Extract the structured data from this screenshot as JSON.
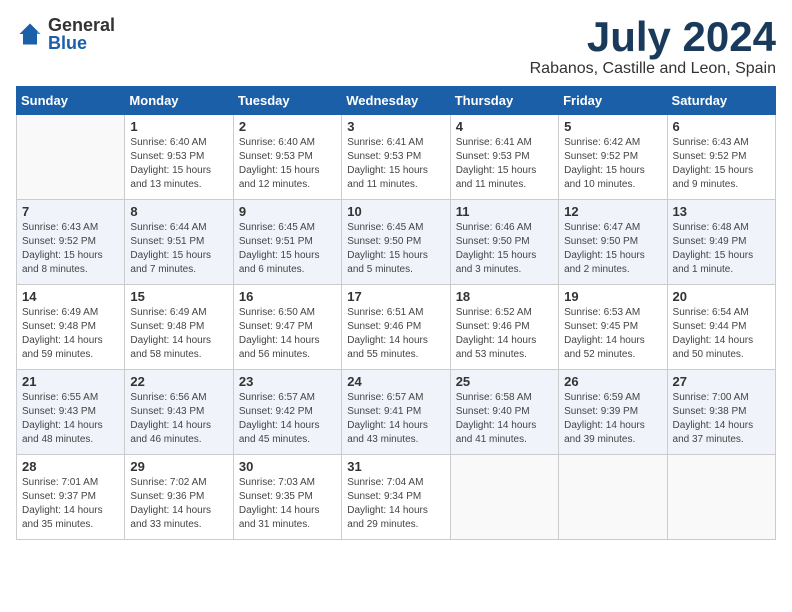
{
  "logo": {
    "general": "General",
    "blue": "Blue"
  },
  "title": "July 2024",
  "location": "Rabanos, Castille and Leon, Spain",
  "days_of_week": [
    "Sunday",
    "Monday",
    "Tuesday",
    "Wednesday",
    "Thursday",
    "Friday",
    "Saturday"
  ],
  "weeks": [
    [
      {
        "day": "",
        "sunrise": "",
        "sunset": "",
        "daylight": ""
      },
      {
        "day": "1",
        "sunrise": "Sunrise: 6:40 AM",
        "sunset": "Sunset: 9:53 PM",
        "daylight": "Daylight: 15 hours and 13 minutes."
      },
      {
        "day": "2",
        "sunrise": "Sunrise: 6:40 AM",
        "sunset": "Sunset: 9:53 PM",
        "daylight": "Daylight: 15 hours and 12 minutes."
      },
      {
        "day": "3",
        "sunrise": "Sunrise: 6:41 AM",
        "sunset": "Sunset: 9:53 PM",
        "daylight": "Daylight: 15 hours and 11 minutes."
      },
      {
        "day": "4",
        "sunrise": "Sunrise: 6:41 AM",
        "sunset": "Sunset: 9:53 PM",
        "daylight": "Daylight: 15 hours and 11 minutes."
      },
      {
        "day": "5",
        "sunrise": "Sunrise: 6:42 AM",
        "sunset": "Sunset: 9:52 PM",
        "daylight": "Daylight: 15 hours and 10 minutes."
      },
      {
        "day": "6",
        "sunrise": "Sunrise: 6:43 AM",
        "sunset": "Sunset: 9:52 PM",
        "daylight": "Daylight: 15 hours and 9 minutes."
      }
    ],
    [
      {
        "day": "7",
        "sunrise": "Sunrise: 6:43 AM",
        "sunset": "Sunset: 9:52 PM",
        "daylight": "Daylight: 15 hours and 8 minutes."
      },
      {
        "day": "8",
        "sunrise": "Sunrise: 6:44 AM",
        "sunset": "Sunset: 9:51 PM",
        "daylight": "Daylight: 15 hours and 7 minutes."
      },
      {
        "day": "9",
        "sunrise": "Sunrise: 6:45 AM",
        "sunset": "Sunset: 9:51 PM",
        "daylight": "Daylight: 15 hours and 6 minutes."
      },
      {
        "day": "10",
        "sunrise": "Sunrise: 6:45 AM",
        "sunset": "Sunset: 9:50 PM",
        "daylight": "Daylight: 15 hours and 5 minutes."
      },
      {
        "day": "11",
        "sunrise": "Sunrise: 6:46 AM",
        "sunset": "Sunset: 9:50 PM",
        "daylight": "Daylight: 15 hours and 3 minutes."
      },
      {
        "day": "12",
        "sunrise": "Sunrise: 6:47 AM",
        "sunset": "Sunset: 9:50 PM",
        "daylight": "Daylight: 15 hours and 2 minutes."
      },
      {
        "day": "13",
        "sunrise": "Sunrise: 6:48 AM",
        "sunset": "Sunset: 9:49 PM",
        "daylight": "Daylight: 15 hours and 1 minute."
      }
    ],
    [
      {
        "day": "14",
        "sunrise": "Sunrise: 6:49 AM",
        "sunset": "Sunset: 9:48 PM",
        "daylight": "Daylight: 14 hours and 59 minutes."
      },
      {
        "day": "15",
        "sunrise": "Sunrise: 6:49 AM",
        "sunset": "Sunset: 9:48 PM",
        "daylight": "Daylight: 14 hours and 58 minutes."
      },
      {
        "day": "16",
        "sunrise": "Sunrise: 6:50 AM",
        "sunset": "Sunset: 9:47 PM",
        "daylight": "Daylight: 14 hours and 56 minutes."
      },
      {
        "day": "17",
        "sunrise": "Sunrise: 6:51 AM",
        "sunset": "Sunset: 9:46 PM",
        "daylight": "Daylight: 14 hours and 55 minutes."
      },
      {
        "day": "18",
        "sunrise": "Sunrise: 6:52 AM",
        "sunset": "Sunset: 9:46 PM",
        "daylight": "Daylight: 14 hours and 53 minutes."
      },
      {
        "day": "19",
        "sunrise": "Sunrise: 6:53 AM",
        "sunset": "Sunset: 9:45 PM",
        "daylight": "Daylight: 14 hours and 52 minutes."
      },
      {
        "day": "20",
        "sunrise": "Sunrise: 6:54 AM",
        "sunset": "Sunset: 9:44 PM",
        "daylight": "Daylight: 14 hours and 50 minutes."
      }
    ],
    [
      {
        "day": "21",
        "sunrise": "Sunrise: 6:55 AM",
        "sunset": "Sunset: 9:43 PM",
        "daylight": "Daylight: 14 hours and 48 minutes."
      },
      {
        "day": "22",
        "sunrise": "Sunrise: 6:56 AM",
        "sunset": "Sunset: 9:43 PM",
        "daylight": "Daylight: 14 hours and 46 minutes."
      },
      {
        "day": "23",
        "sunrise": "Sunrise: 6:57 AM",
        "sunset": "Sunset: 9:42 PM",
        "daylight": "Daylight: 14 hours and 45 minutes."
      },
      {
        "day": "24",
        "sunrise": "Sunrise: 6:57 AM",
        "sunset": "Sunset: 9:41 PM",
        "daylight": "Daylight: 14 hours and 43 minutes."
      },
      {
        "day": "25",
        "sunrise": "Sunrise: 6:58 AM",
        "sunset": "Sunset: 9:40 PM",
        "daylight": "Daylight: 14 hours and 41 minutes."
      },
      {
        "day": "26",
        "sunrise": "Sunrise: 6:59 AM",
        "sunset": "Sunset: 9:39 PM",
        "daylight": "Daylight: 14 hours and 39 minutes."
      },
      {
        "day": "27",
        "sunrise": "Sunrise: 7:00 AM",
        "sunset": "Sunset: 9:38 PM",
        "daylight": "Daylight: 14 hours and 37 minutes."
      }
    ],
    [
      {
        "day": "28",
        "sunrise": "Sunrise: 7:01 AM",
        "sunset": "Sunset: 9:37 PM",
        "daylight": "Daylight: 14 hours and 35 minutes."
      },
      {
        "day": "29",
        "sunrise": "Sunrise: 7:02 AM",
        "sunset": "Sunset: 9:36 PM",
        "daylight": "Daylight: 14 hours and 33 minutes."
      },
      {
        "day": "30",
        "sunrise": "Sunrise: 7:03 AM",
        "sunset": "Sunset: 9:35 PM",
        "daylight": "Daylight: 14 hours and 31 minutes."
      },
      {
        "day": "31",
        "sunrise": "Sunrise: 7:04 AM",
        "sunset": "Sunset: 9:34 PM",
        "daylight": "Daylight: 14 hours and 29 minutes."
      },
      {
        "day": "",
        "sunrise": "",
        "sunset": "",
        "daylight": ""
      },
      {
        "day": "",
        "sunrise": "",
        "sunset": "",
        "daylight": ""
      },
      {
        "day": "",
        "sunrise": "",
        "sunset": "",
        "daylight": ""
      }
    ]
  ]
}
